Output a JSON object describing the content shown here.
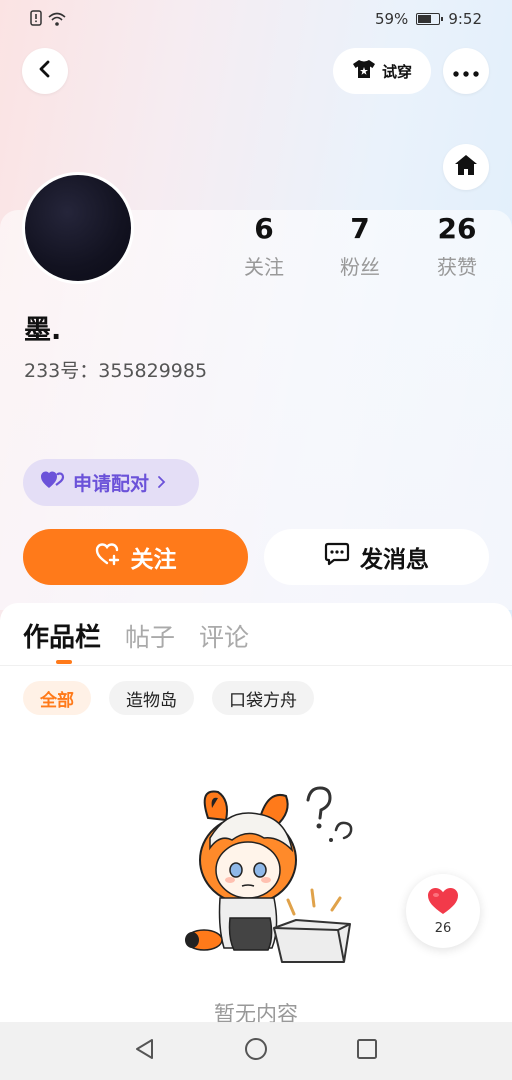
{
  "status_bar": {
    "battery_percent": "59%",
    "battery_level": 0.59,
    "time": "9:52"
  },
  "header": {
    "try_on_label": "试穿"
  },
  "profile": {
    "username": "墨.",
    "uid_text": "233号：355829985",
    "stats": [
      {
        "value": "6",
        "label": "关注"
      },
      {
        "value": "7",
        "label": "粉丝"
      },
      {
        "value": "26",
        "label": "获赞"
      }
    ],
    "pair_button_label": "申请配对",
    "follow_button_label": "关注",
    "message_button_label": "发消息"
  },
  "tabs": [
    {
      "label": "作品栏",
      "active": true
    },
    {
      "label": "帖子",
      "active": false
    },
    {
      "label": "评论",
      "active": false
    }
  ],
  "filter_chips": [
    {
      "label": "全部",
      "active": true
    },
    {
      "label": "造物岛",
      "active": false
    },
    {
      "label": "口袋方舟",
      "active": false
    }
  ],
  "empty_state": {
    "text": "暂无内容"
  },
  "floating_like": {
    "count": "26"
  },
  "colors": {
    "accent": "#ff7a1a",
    "pair_purple": "#6b52d9",
    "heart_red": "#f23a4a"
  }
}
